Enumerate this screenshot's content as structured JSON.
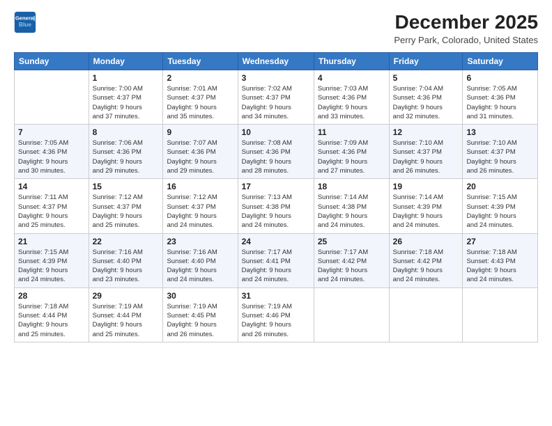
{
  "logo": {
    "general": "General",
    "blue": "Blue"
  },
  "header": {
    "title": "December 2025",
    "subtitle": "Perry Park, Colorado, United States"
  },
  "weekdays": [
    "Sunday",
    "Monday",
    "Tuesday",
    "Wednesday",
    "Thursday",
    "Friday",
    "Saturday"
  ],
  "weeks": [
    [
      {
        "day": "",
        "info": ""
      },
      {
        "day": "1",
        "info": "Sunrise: 7:00 AM\nSunset: 4:37 PM\nDaylight: 9 hours\nand 37 minutes."
      },
      {
        "day": "2",
        "info": "Sunrise: 7:01 AM\nSunset: 4:37 PM\nDaylight: 9 hours\nand 35 minutes."
      },
      {
        "day": "3",
        "info": "Sunrise: 7:02 AM\nSunset: 4:37 PM\nDaylight: 9 hours\nand 34 minutes."
      },
      {
        "day": "4",
        "info": "Sunrise: 7:03 AM\nSunset: 4:36 PM\nDaylight: 9 hours\nand 33 minutes."
      },
      {
        "day": "5",
        "info": "Sunrise: 7:04 AM\nSunset: 4:36 PM\nDaylight: 9 hours\nand 32 minutes."
      },
      {
        "day": "6",
        "info": "Sunrise: 7:05 AM\nSunset: 4:36 PM\nDaylight: 9 hours\nand 31 minutes."
      }
    ],
    [
      {
        "day": "7",
        "info": "Sunrise: 7:05 AM\nSunset: 4:36 PM\nDaylight: 9 hours\nand 30 minutes."
      },
      {
        "day": "8",
        "info": "Sunrise: 7:06 AM\nSunset: 4:36 PM\nDaylight: 9 hours\nand 29 minutes."
      },
      {
        "day": "9",
        "info": "Sunrise: 7:07 AM\nSunset: 4:36 PM\nDaylight: 9 hours\nand 29 minutes."
      },
      {
        "day": "10",
        "info": "Sunrise: 7:08 AM\nSunset: 4:36 PM\nDaylight: 9 hours\nand 28 minutes."
      },
      {
        "day": "11",
        "info": "Sunrise: 7:09 AM\nSunset: 4:36 PM\nDaylight: 9 hours\nand 27 minutes."
      },
      {
        "day": "12",
        "info": "Sunrise: 7:10 AM\nSunset: 4:37 PM\nDaylight: 9 hours\nand 26 minutes."
      },
      {
        "day": "13",
        "info": "Sunrise: 7:10 AM\nSunset: 4:37 PM\nDaylight: 9 hours\nand 26 minutes."
      }
    ],
    [
      {
        "day": "14",
        "info": "Sunrise: 7:11 AM\nSunset: 4:37 PM\nDaylight: 9 hours\nand 25 minutes."
      },
      {
        "day": "15",
        "info": "Sunrise: 7:12 AM\nSunset: 4:37 PM\nDaylight: 9 hours\nand 25 minutes."
      },
      {
        "day": "16",
        "info": "Sunrise: 7:12 AM\nSunset: 4:37 PM\nDaylight: 9 hours\nand 24 minutes."
      },
      {
        "day": "17",
        "info": "Sunrise: 7:13 AM\nSunset: 4:38 PM\nDaylight: 9 hours\nand 24 minutes."
      },
      {
        "day": "18",
        "info": "Sunrise: 7:14 AM\nSunset: 4:38 PM\nDaylight: 9 hours\nand 24 minutes."
      },
      {
        "day": "19",
        "info": "Sunrise: 7:14 AM\nSunset: 4:39 PM\nDaylight: 9 hours\nand 24 minutes."
      },
      {
        "day": "20",
        "info": "Sunrise: 7:15 AM\nSunset: 4:39 PM\nDaylight: 9 hours\nand 24 minutes."
      }
    ],
    [
      {
        "day": "21",
        "info": "Sunrise: 7:15 AM\nSunset: 4:39 PM\nDaylight: 9 hours\nand 24 minutes."
      },
      {
        "day": "22",
        "info": "Sunrise: 7:16 AM\nSunset: 4:40 PM\nDaylight: 9 hours\nand 23 minutes."
      },
      {
        "day": "23",
        "info": "Sunrise: 7:16 AM\nSunset: 4:40 PM\nDaylight: 9 hours\nand 24 minutes."
      },
      {
        "day": "24",
        "info": "Sunrise: 7:17 AM\nSunset: 4:41 PM\nDaylight: 9 hours\nand 24 minutes."
      },
      {
        "day": "25",
        "info": "Sunrise: 7:17 AM\nSunset: 4:42 PM\nDaylight: 9 hours\nand 24 minutes."
      },
      {
        "day": "26",
        "info": "Sunrise: 7:18 AM\nSunset: 4:42 PM\nDaylight: 9 hours\nand 24 minutes."
      },
      {
        "day": "27",
        "info": "Sunrise: 7:18 AM\nSunset: 4:43 PM\nDaylight: 9 hours\nand 24 minutes."
      }
    ],
    [
      {
        "day": "28",
        "info": "Sunrise: 7:18 AM\nSunset: 4:44 PM\nDaylight: 9 hours\nand 25 minutes."
      },
      {
        "day": "29",
        "info": "Sunrise: 7:19 AM\nSunset: 4:44 PM\nDaylight: 9 hours\nand 25 minutes."
      },
      {
        "day": "30",
        "info": "Sunrise: 7:19 AM\nSunset: 4:45 PM\nDaylight: 9 hours\nand 26 minutes."
      },
      {
        "day": "31",
        "info": "Sunrise: 7:19 AM\nSunset: 4:46 PM\nDaylight: 9 hours\nand 26 minutes."
      },
      {
        "day": "",
        "info": ""
      },
      {
        "day": "",
        "info": ""
      },
      {
        "day": "",
        "info": ""
      }
    ]
  ]
}
